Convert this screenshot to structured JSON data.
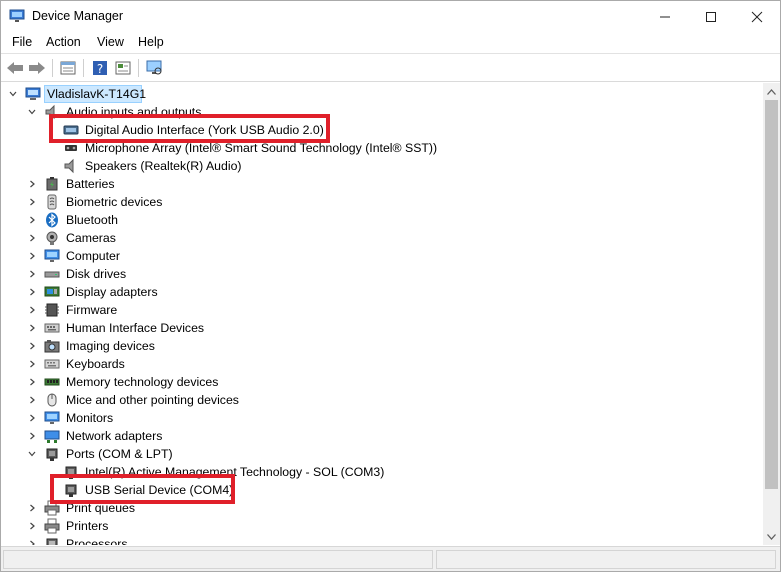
{
  "window": {
    "title": "Device Manager",
    "controls": {
      "minimize": "—",
      "maximize": "☐",
      "close": "✕"
    }
  },
  "menu": [
    {
      "id": "file",
      "label": "File"
    },
    {
      "id": "action",
      "label": "Action"
    },
    {
      "id": "view",
      "label": "View"
    },
    {
      "id": "help",
      "label": "Help"
    }
  ],
  "toolbar": {
    "buttons": [
      "back-icon",
      "forward-icon",
      "properties-icon",
      "help-icon",
      "update-driver-icon",
      "scan-hardware-icon"
    ]
  },
  "tree": {
    "root": {
      "label": "VladislavK-T14G1",
      "icon": "computer-icon",
      "expanded": true
    },
    "items": [
      {
        "label": "Audio inputs and outputs",
        "level": 1,
        "expander": "expanded",
        "icon": "speaker-icon"
      },
      {
        "label": "Digital Audio Interface (York USB Audio 2.0)",
        "level": 2,
        "expander": "none",
        "icon": "audio-device-icon"
      },
      {
        "label": "Microphone Array (Intel® Smart Sound Technology (Intel® SST))",
        "level": 2,
        "expander": "none",
        "icon": "microphone-icon"
      },
      {
        "label": "Speakers (Realtek(R) Audio)",
        "level": 2,
        "expander": "none",
        "icon": "speaker-icon"
      },
      {
        "label": "Batteries",
        "level": 1,
        "expander": "collapsed",
        "icon": "battery-icon"
      },
      {
        "label": "Biometric devices",
        "level": 1,
        "expander": "collapsed",
        "icon": "biometric-icon"
      },
      {
        "label": "Bluetooth",
        "level": 1,
        "expander": "collapsed",
        "icon": "bluetooth-icon"
      },
      {
        "label": "Cameras",
        "level": 1,
        "expander": "collapsed",
        "icon": "camera-icon"
      },
      {
        "label": "Computer",
        "level": 1,
        "expander": "collapsed",
        "icon": "monitor-icon"
      },
      {
        "label": "Disk drives",
        "level": 1,
        "expander": "collapsed",
        "icon": "disk-drive-icon"
      },
      {
        "label": "Display adapters",
        "level": 1,
        "expander": "collapsed",
        "icon": "display-adapter-icon"
      },
      {
        "label": "Firmware",
        "level": 1,
        "expander": "collapsed",
        "icon": "firmware-icon"
      },
      {
        "label": "Human Interface Devices",
        "level": 1,
        "expander": "collapsed",
        "icon": "hid-icon"
      },
      {
        "label": "Imaging devices",
        "level": 1,
        "expander": "collapsed",
        "icon": "imaging-icon"
      },
      {
        "label": "Keyboards",
        "level": 1,
        "expander": "collapsed",
        "icon": "keyboard-icon"
      },
      {
        "label": "Memory technology devices",
        "level": 1,
        "expander": "collapsed",
        "icon": "memory-icon"
      },
      {
        "label": "Mice and other pointing devices",
        "level": 1,
        "expander": "collapsed",
        "icon": "mouse-icon"
      },
      {
        "label": "Monitors",
        "level": 1,
        "expander": "collapsed",
        "icon": "monitor-icon"
      },
      {
        "label": "Network adapters",
        "level": 1,
        "expander": "collapsed",
        "icon": "network-icon"
      },
      {
        "label": "Ports (COM & LPT)",
        "level": 1,
        "expander": "expanded",
        "icon": "port-icon"
      },
      {
        "label": "Intel(R) Active Management Technology - SOL (COM3)",
        "level": 2,
        "expander": "none",
        "icon": "port-icon"
      },
      {
        "label": "USB Serial Device (COM4)",
        "level": 2,
        "expander": "none",
        "icon": "port-icon"
      },
      {
        "label": "Print queues",
        "level": 1,
        "expander": "collapsed",
        "icon": "printer-icon"
      },
      {
        "label": "Printers",
        "level": 1,
        "expander": "collapsed",
        "icon": "printer-icon"
      },
      {
        "label": "Processors",
        "level": 1,
        "expander": "collapsed",
        "icon": "processor-icon"
      }
    ]
  },
  "annotations": {
    "color": "#e0202a",
    "highlighted": [
      "Digital Audio Interface (York USB Audio 2.0)",
      "USB Serial Device (COM4)"
    ]
  },
  "colors": {
    "selection_bg": "#cce8ff",
    "selection_border": "#99d1ff"
  }
}
